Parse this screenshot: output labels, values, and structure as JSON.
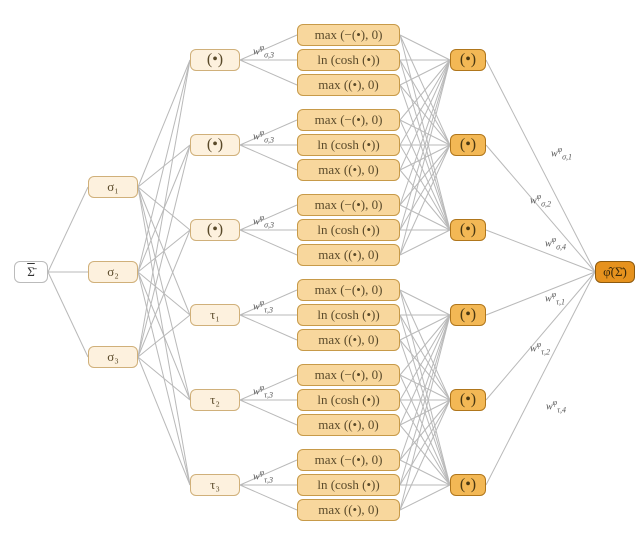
{
  "input": {
    "label": "Σ̄"
  },
  "sigmas": {
    "s1": "σ₁",
    "s2": "σ₂",
    "s3": "σ₃"
  },
  "mid": {
    "dot1": "(•)",
    "dot2": "(•)",
    "dot3": "(•)",
    "t1": "τ₁",
    "t2": "τ₂",
    "t3": "τ₃"
  },
  "acts": {
    "neg": "max (−(•), 0)",
    "lnc": "ln (cosh (•))",
    "pos": "max ((•), 0)"
  },
  "agg": {
    "d1": "(•)",
    "d2": "(•)",
    "d3": "(•)",
    "d4": "(•)",
    "d5": "(•)",
    "d6": "(•)"
  },
  "out": {
    "label": "φ̂(Σ̄)"
  },
  "w_inner_html": {
    "s1": "w<sup>φ</sup><sub>σ,3</sub>",
    "s2": "w<sup>φ</sup><sub>σ,3</sub>",
    "s3": "w<sup>φ</sup><sub>σ,3</sub>",
    "t1": "w<sup>φ</sup><sub>τ,3</sub>",
    "t2": "w<sup>φ</sup><sub>τ,3</sub>",
    "t3": "w<sup>φ</sup><sub>τ,3</sub>"
  },
  "w_outer_html": {
    "o1": "w<sup>φ</sup><sub>σ,1</sub>",
    "o2": "w<sup>φ</sup><sub>σ,2</sub>",
    "o3": "w<sup>φ</sup><sub>σ,4</sub>",
    "o4": "w<sup>φ</sup><sub>τ,1</sub>",
    "o5": "w<sup>φ</sup><sub>τ,2</sub>",
    "o6": "w<sup>φ</sup><sub>τ,4</sub>"
  }
}
